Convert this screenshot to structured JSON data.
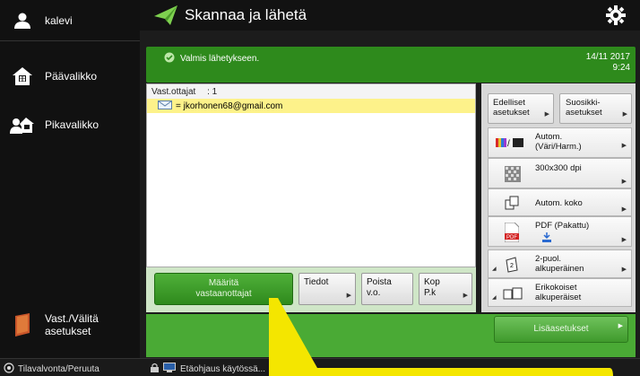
{
  "user": {
    "name": "kalevi"
  },
  "sidebar": {
    "items": [
      {
        "label": "Päävalikko",
        "icon": "home-icon"
      },
      {
        "label": "Pikavalikko",
        "icon": "quick-menu-icon"
      },
      {
        "label_line1": "Vast./Välitä",
        "label_line2": "asetukset",
        "icon": "address-book-icon"
      }
    ]
  },
  "header": {
    "title": "Skannaa ja lähetä",
    "settings_icon": "gear-icon"
  },
  "status": {
    "message": "Valmis lähetykseen.",
    "date": "14/11 2017",
    "time": "9:24"
  },
  "recipients": {
    "header_label": "Vast.ottajat",
    "count": ": 1",
    "items": [
      {
        "text": "= jkorhonen68@gmail.com"
      }
    ]
  },
  "actions": {
    "specify": {
      "line1": "Määritä",
      "line2": "vastaanottajat"
    },
    "details": "Tiedot",
    "remove": {
      "line1": "Poista",
      "line2": "v.o."
    },
    "copy": {
      "line1": "Kop",
      "line2": "P.k"
    }
  },
  "settings": {
    "previous": {
      "line1": "Edelliset",
      "line2": "asetukset"
    },
    "favorites": {
      "line1": "Suosikki-",
      "line2": "asetukset"
    },
    "color": {
      "line1": "Autom.",
      "line2": "(Väri/Harm.)"
    },
    "resolution": "300x300 dpi",
    "size": "Autom. koko",
    "format": "PDF (Pakattu)",
    "duplex": {
      "line1": "2-puol.",
      "line2": "alkuperäinen"
    },
    "mixed": {
      "line1": "Erikokoiset",
      "line2": "alkuperäiset"
    },
    "more": "Lisäasetukset"
  },
  "footer": {
    "left": "Tilavalvonta/Peruuta",
    "mid": "Etäohjaus käytössä..."
  },
  "colors": {
    "accent_green": "#2e8a1c",
    "highlight_yellow": "#fdf28a",
    "overlay_yellow": "#f4e600"
  }
}
